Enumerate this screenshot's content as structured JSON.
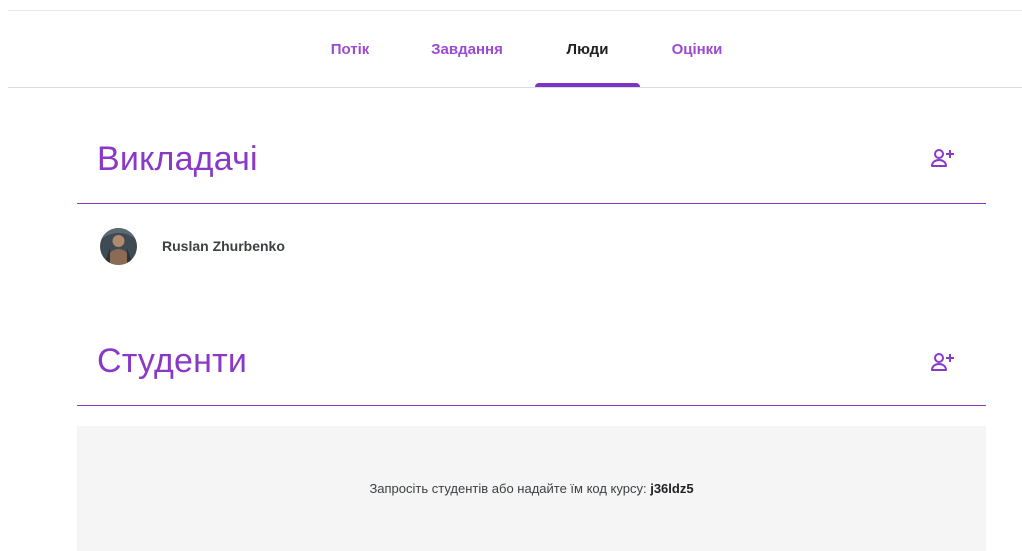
{
  "tabs": [
    {
      "label": "Потік",
      "active": false
    },
    {
      "label": "Завдання",
      "active": false
    },
    {
      "label": "Люди",
      "active": true
    },
    {
      "label": "Оцінки",
      "active": false
    }
  ],
  "teachers_section": {
    "title": "Викладачі",
    "add_icon": "person-add-icon",
    "members": [
      {
        "name": "Ruslan Zhurbenko",
        "avatar_icon": "avatar-photo"
      }
    ]
  },
  "students_section": {
    "title": "Студенти",
    "add_icon": "person-add-icon",
    "invite_text": "Запросіть студентів або надайте їм код курсу: ",
    "course_code": "j36ldz5"
  },
  "colors": {
    "accent": "#8a39c7",
    "tab_text": "#9c4bd1",
    "active_tab_text": "#202124",
    "indicator": "#7e33c2",
    "empty_box_bg": "#f5f5f5"
  }
}
